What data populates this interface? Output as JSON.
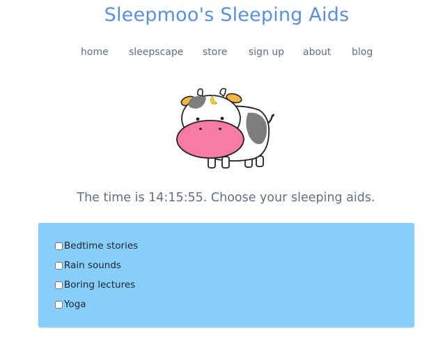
{
  "header": {
    "title": "Sleepmoo's Sleeping Aids"
  },
  "nav": {
    "items": [
      {
        "label": "home"
      },
      {
        "label": "sleepscape"
      },
      {
        "label": "store"
      },
      {
        "label": "sign up"
      },
      {
        "label": "about"
      },
      {
        "label": "blog"
      }
    ]
  },
  "mascot": {
    "icon": "cow-mascot-icon"
  },
  "main": {
    "time_text": "The time is 14:15:55. Choose your sleeping aids."
  },
  "aids": {
    "items": [
      {
        "label": "Bedtime stories",
        "checked": false
      },
      {
        "label": "Rain sounds",
        "checked": false
      },
      {
        "label": "Boring lectures",
        "checked": false
      },
      {
        "label": "Yoga",
        "checked": false
      }
    ]
  },
  "colors": {
    "title": "#5b8fd9",
    "nav_text": "#5b6e8a",
    "panel_bg": "#87cefa",
    "cow_nose": "#f87aa6"
  }
}
